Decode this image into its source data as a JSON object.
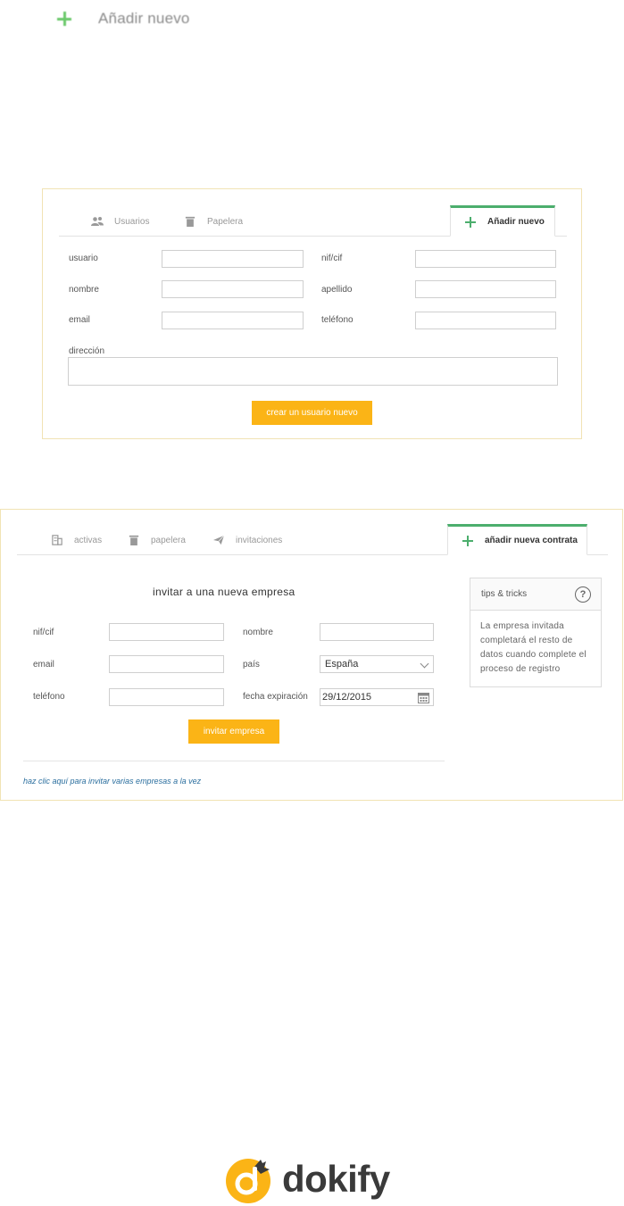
{
  "top_heading": {
    "label": "Añadir nuevo"
  },
  "panel1": {
    "tabs": [
      {
        "label": "Usuarios",
        "icon": "users-icon"
      },
      {
        "label": "Papelera",
        "icon": "trash-icon"
      },
      {
        "label": "Añadir nuevo",
        "icon": "plus-icon",
        "active": true
      }
    ],
    "fields": {
      "usuario": "usuario",
      "nif_cif": "nif/cif",
      "nombre": "nombre",
      "apellido": "apellido",
      "email": "email",
      "telefono": "teléfono",
      "direccion": "dirección"
    },
    "submit_label": "crear un usuario nuevo"
  },
  "panel2": {
    "tabs": [
      {
        "label": "activas",
        "icon": "building-icon"
      },
      {
        "label": "papelera",
        "icon": "trash-icon"
      },
      {
        "label": "invitaciones",
        "icon": "paper-plane-icon"
      },
      {
        "label": "añadir nueva contrata",
        "icon": "plus-icon",
        "active": true
      }
    ],
    "section_title": "invitar a una nueva empresa",
    "fields": {
      "nif_cif": "nif/cif",
      "nombre": "nombre",
      "email": "email",
      "pais": "país",
      "pais_value": "España",
      "telefono": "teléfono",
      "fecha_expiracion": "fecha expiración",
      "fecha_value": "29/12/2015"
    },
    "submit_label": "invitar empresa",
    "bulk_link": "haz clic aquí para invitar varias empresas a la vez",
    "tips": {
      "title": "tips & tricks",
      "body": "La empresa invitada completará el resto de datos cuando complete el proceso de registro"
    }
  },
  "brand": {
    "name": "dokify",
    "colors": {
      "accent": "#fbb416",
      "green": "#4cae6d",
      "text": "#3a3a3a"
    }
  }
}
